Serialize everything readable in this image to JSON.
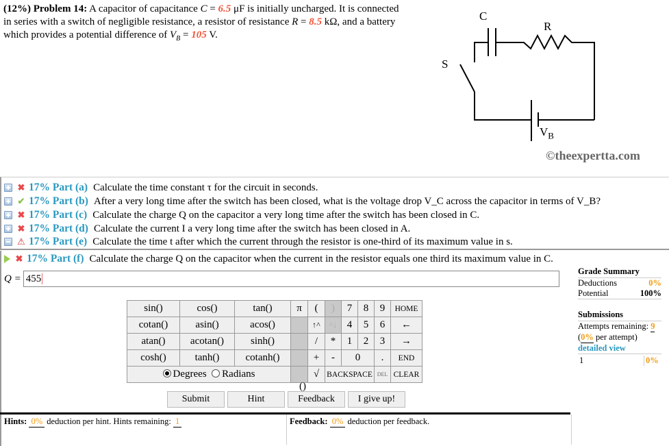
{
  "problem": {
    "weight": "(12%)",
    "title": "Problem 14:",
    "text1": "A capacitor of capacitance",
    "c_var": "C",
    "eq": "=",
    "c_val": "6.5",
    "c_unit": "μF is initially uncharged. It is connected in series with a switch of negligible resistance, a resistor of resistance",
    "r_var": "R",
    "r_val": "8.5",
    "r_unit": "kΩ, and a battery which provides a potential difference of",
    "v_var": "V",
    "v_sub": "B",
    "v_val": "105",
    "v_unit": "V."
  },
  "circuit": {
    "label_c": "C",
    "label_r": "R",
    "label_s": "S",
    "label_v": "V",
    "label_v_sub": "B",
    "watermark": "©theexpertta.com"
  },
  "parts": [
    {
      "expand": "plus",
      "status": "x",
      "label": "17% Part (a)",
      "text": "Calculate the time constant τ for the circuit in seconds."
    },
    {
      "expand": "plus",
      "status": "check",
      "label": "17% Part (b)",
      "text": "After a very long time after the switch has been closed, what is the voltage drop V_C across the capacitor in terms of V_B?"
    },
    {
      "expand": "plus",
      "status": "x",
      "label": "17% Part (c)",
      "text": "Calculate the charge Q on the capacitor a very long time after the switch has been closed in C."
    },
    {
      "expand": "plus",
      "status": "x",
      "label": "17% Part (d)",
      "text": "Calculate the current I a very long time after the switch has been closed in A."
    },
    {
      "expand": "minus",
      "status": "warn",
      "label": "17% Part (e)",
      "text": "Calculate the time t after which the current through the resistor is one-third of its maximum value in s."
    }
  ],
  "active_part": {
    "status": "x",
    "label": "17% Part (f)",
    "text": "Calculate the charge Q on the capacitor when the current in the resistor equals one third its maximum value in C.",
    "answer_label": "Q =",
    "answer_value": "455"
  },
  "calculator": {
    "functions": [
      [
        "sin()",
        "cos()",
        "tan()"
      ],
      [
        "cotan()",
        "asin()",
        "acos()"
      ],
      [
        "atan()",
        "acotan()",
        "sinh()"
      ],
      [
        "cosh()",
        "tanh()",
        "cotanh()"
      ]
    ],
    "degrees": "Degrees",
    "radians": "Radians",
    "mode": "Degrees",
    "keys": {
      "pi": "π",
      "lparen": "(",
      "rparen": ")",
      "up": "↑^",
      "down": "^↓",
      "div": "/",
      "mul": "*",
      "plus": "+",
      "minus": "-",
      "sqrt": "√",
      "d7": "7",
      "d8": "8",
      "d9": "9",
      "d4": "4",
      "d5": "5",
      "d6": "6",
      "d1": "1",
      "d2": "2",
      "d3": "3",
      "d0": "0",
      "dot": ".",
      "home": "HOME",
      "left": "←",
      "right": "→",
      "end": "END",
      "backspace": "BACKSPACE",
      "del": "DEL",
      "clear": "CLEAR",
      "paren_pair": "()"
    }
  },
  "buttons": {
    "submit": "Submit",
    "hint": "Hint",
    "feedback": "Feedback",
    "give_up": "I give up!"
  },
  "grade_summary": {
    "title": "Grade Summary",
    "deductions_label": "Deductions",
    "deductions_value": "0%",
    "potential_label": "Potential",
    "potential_value": "100%",
    "submissions_title": "Submissions",
    "attempts_label": "Attempts remaining:",
    "attempts_value": "9",
    "per_attempt_open": "(",
    "per_attempt_value": "0%",
    "per_attempt_text": "per attempt)",
    "detailed_view": "detailed view",
    "history": [
      {
        "n": "1",
        "value": "0%"
      }
    ]
  },
  "hints": {
    "label": "Hints:",
    "value": "0%",
    "text": "deduction per hint. Hints remaining:",
    "remaining": "1"
  },
  "feedback": {
    "label": "Feedback:",
    "value": "0%",
    "text": "deduction per feedback."
  }
}
